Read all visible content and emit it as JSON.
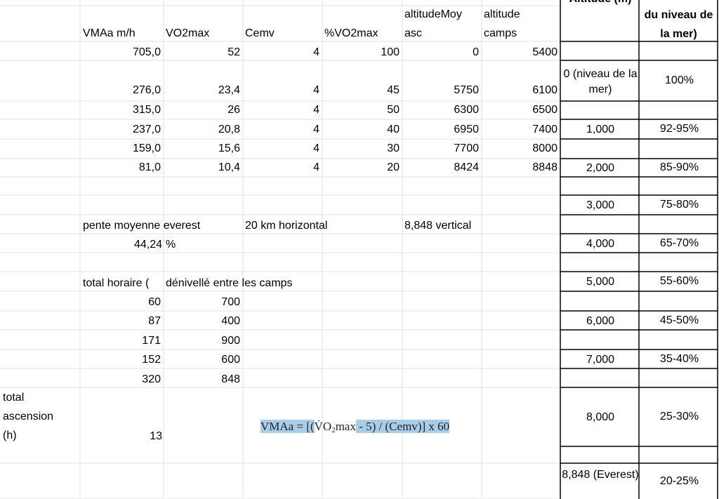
{
  "headers": {
    "vmaa": "VMAa m/h",
    "vo2max": "VO2max",
    "cemv": "Cemv",
    "pct_vo2max": "%VO2max",
    "altitude_moy_line1": "altitudeMoy",
    "altitude_moy_line2": "asc",
    "altitude_camps_line1": "altitude",
    "altitude_camps_line2": "camps",
    "altitude_m": "Altitude (m)",
    "niveau_mer": "du niveau de la mer)"
  },
  "main_rows": [
    {
      "vmaa": "705,0",
      "vo2max": "52",
      "cemv": "4",
      "pct": "100",
      "alt_moy": "0",
      "alt_camps": "5400"
    },
    {
      "vmaa": "276,0",
      "vo2max": "23,4",
      "cemv": "4",
      "pct": "45",
      "alt_moy": "5750",
      "alt_camps": "6100"
    },
    {
      "vmaa": "315,0",
      "vo2max": "26",
      "cemv": "4",
      "pct": "50",
      "alt_moy": "6300",
      "alt_camps": "6500"
    },
    {
      "vmaa": "237,0",
      "vo2max": "20,8",
      "cemv": "4",
      "pct": "40",
      "alt_moy": "6950",
      "alt_camps": "7400"
    },
    {
      "vmaa": "159,0",
      "vo2max": "15,6",
      "cemv": "4",
      "pct": "30",
      "alt_moy": "7700",
      "alt_camps": "8000"
    },
    {
      "vmaa": "81,0",
      "vo2max": "10,4",
      "cemv": "4",
      "pct": "20",
      "alt_moy": "8424",
      "alt_camps": "8848"
    }
  ],
  "slope": {
    "label": "pente moyenne everest",
    "horizontal": "20 km horizontal",
    "vertical": "8,848 vertical",
    "value": "44,24",
    "unit": "%"
  },
  "camps_table": {
    "header_total": "total horaire (",
    "header_denivelle": "dénivellé entre les camps",
    "rows": [
      {
        "total": "60",
        "denivelle": "700"
      },
      {
        "total": "87",
        "denivelle": "400"
      },
      {
        "total": "171",
        "denivelle": "900"
      },
      {
        "total": "152",
        "denivelle": "600"
      },
      {
        "total": "320",
        "denivelle": "848"
      }
    ]
  },
  "total_ascension": {
    "label_line1": "total",
    "label_line2": "ascension",
    "label_line3": "(h)",
    "value": "13"
  },
  "altitude_table": [
    {
      "altitude": "0 (niveau de la mer)",
      "percent": "100%"
    },
    {
      "altitude": "1,000",
      "percent": "92-95%"
    },
    {
      "altitude": "2,000",
      "percent": "85-90%"
    },
    {
      "altitude": "3,000",
      "percent": "75-80%"
    },
    {
      "altitude": "4,000",
      "percent": "65-70%"
    },
    {
      "altitude": "5,000",
      "percent": "55-60%"
    },
    {
      "altitude": "6,000",
      "percent": "45-50%"
    },
    {
      "altitude": "7,000",
      "percent": "35-40%"
    },
    {
      "altitude": "8,000",
      "percent": "25-30%"
    },
    {
      "altitude": "8,848 (Everest)",
      "percent": "20-25%"
    }
  ],
  "formula": {
    "lhs": "VMAa = [(",
    "v_dot": "V̇O",
    "subscript": "2",
    "max": "max",
    "rest": " - 5) / (Cemv)] x 60"
  },
  "colors": {
    "gridline": "#e1e1e1",
    "border": "#000000",
    "highlight": "#a9cce8"
  }
}
